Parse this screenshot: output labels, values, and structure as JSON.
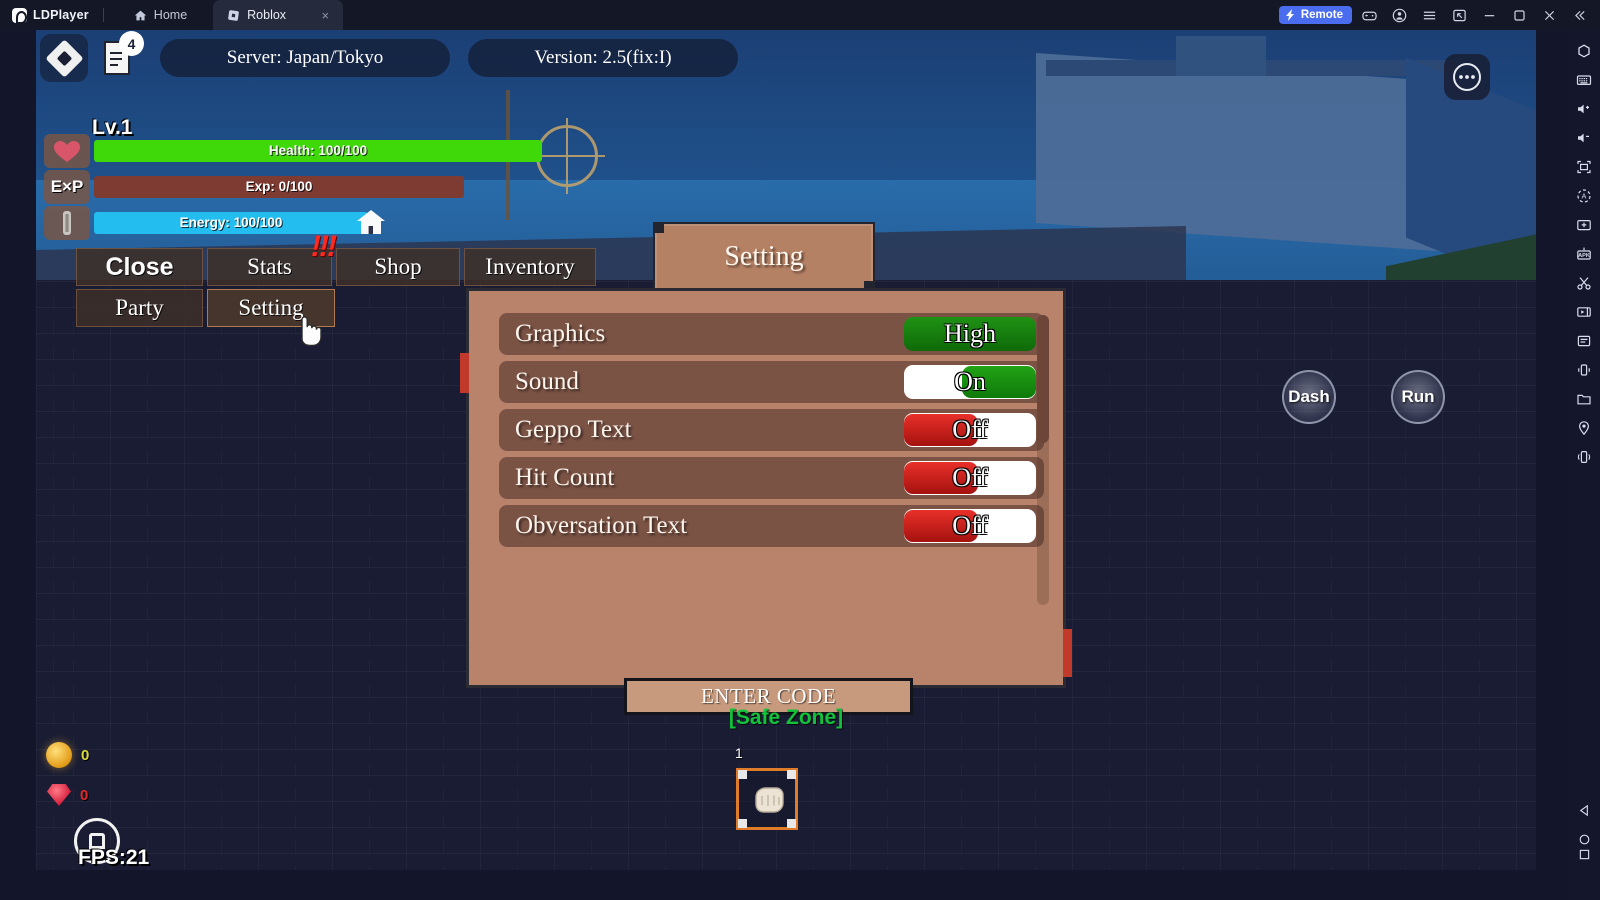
{
  "emulator": {
    "brand": "LDPlayer",
    "tabs": [
      {
        "label": "Home",
        "icon": "home-icon",
        "active": false
      },
      {
        "label": "Roblox",
        "icon": "roblox-icon",
        "active": true,
        "close": "×"
      }
    ],
    "remote_label": "Remote",
    "titlebar_buttons": [
      "gamepad-icon",
      "account-icon",
      "menu-icon",
      "multi-instance-icon",
      "minimize-icon",
      "maximize-icon",
      "close-icon",
      "collapse-icon"
    ],
    "sidebar_icons": [
      "fullscreen-hex-icon",
      "keyboard-icon",
      "volume-up-icon",
      "volume-down-icon",
      "resize-icon",
      "auto-rotate-icon",
      "screenshot-icon",
      "apk-install-icon",
      "scissors-icon",
      "video-record-icon",
      "script-icon",
      "shake-icon",
      "folder-icon",
      "location-icon",
      "virtual-device-icon"
    ],
    "nav_icons": [
      "back-icon",
      "home-circle-icon",
      "recents-icon"
    ]
  },
  "game": {
    "topbar": {
      "notification_count": "4",
      "server": "Server: Japan/Tokyo",
      "version": "Version: 2.5(fix:I)",
      "more_icon": "ellipsis-icon",
      "roblox_icon": "roblox-logo-icon",
      "quest_icon": "quest-log-icon"
    },
    "player": {
      "level": "Lv.1",
      "bars": [
        {
          "icon": "heart-icon",
          "label": "Health: 100/100",
          "percent": 100,
          "color": "#3fd90a"
        },
        {
          "icon": "exp-icon",
          "label": "Exp: 0/100",
          "percent": 0,
          "color": "#7e3b32"
        },
        {
          "icon": "energy-icon",
          "label": "Energy: 100/100",
          "percent": 100,
          "color": "#24bdf0"
        }
      ],
      "home_icon": "house-icon"
    },
    "menu": {
      "row1": [
        "Close",
        "Stats",
        "Shop",
        "Inventory"
      ],
      "row2": [
        "Party",
        "Setting"
      ],
      "alert_marks": "!!!",
      "cursor_icon": "pointer-hand-icon"
    },
    "action_buttons": [
      {
        "label": "Dash"
      },
      {
        "label": "Run"
      }
    ],
    "zone_text": "[Safe Zone]",
    "hotbar": [
      {
        "number": "1",
        "icon": "fist-icon",
        "selected": true
      }
    ],
    "counters": [
      {
        "icon": "coin-icon",
        "value": "0",
        "color": "#d9d93a"
      },
      {
        "icon": "gem-icon",
        "value": "0",
        "color": "#e02b2b"
      }
    ],
    "fps": "FPS:21"
  },
  "setting_dialog": {
    "title": "Setting",
    "rows": [
      {
        "label": "Graphics",
        "control": "value",
        "value": "High",
        "state": "high"
      },
      {
        "label": "Sound",
        "control": "toggle",
        "value": "On",
        "state": "on"
      },
      {
        "label": "Geppo Text",
        "control": "toggle",
        "value": "Off",
        "state": "off"
      },
      {
        "label": "Hit Count",
        "control": "toggle",
        "value": "Off",
        "state": "off"
      },
      {
        "label": "Obversation Text",
        "control": "toggle",
        "value": "Off",
        "state": "off"
      }
    ],
    "enter_code_label": "ENTER CODE",
    "scrollbar": {
      "visible": true
    }
  },
  "colors": {
    "accent_blue": "#4a6df0",
    "panel_brown": "#b8836a",
    "row_brown": "#7b5345",
    "on_green": "#16920f",
    "off_red": "#c0120e",
    "health_green": "#3fd90a",
    "energy_blue": "#24bdf0",
    "code_panel": "#c79a7d"
  }
}
